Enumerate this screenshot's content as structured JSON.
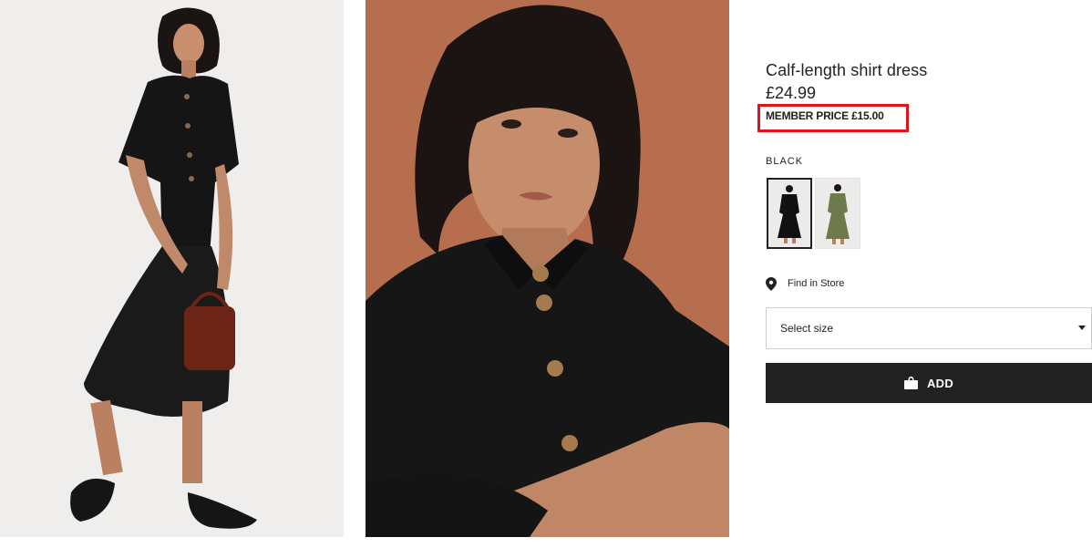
{
  "product": {
    "title": "Calf-length shirt dress",
    "price": "£24.99",
    "member_price": "MEMBER PRICE £15.00"
  },
  "color": {
    "selected_name": "BLACK",
    "swatches": [
      {
        "name": "black",
        "hex": "#111111",
        "selected": true
      },
      {
        "name": "khaki-green",
        "hex": "#6f7a4c",
        "selected": false
      }
    ]
  },
  "store": {
    "label": "Find in Store",
    "icon": "location-pin-icon"
  },
  "size": {
    "placeholder": "Select size",
    "icon": "caret-down-icon"
  },
  "add_button": {
    "label": "ADD",
    "icon": "shopping-bag-icon"
  },
  "highlight": {
    "color": "#e0141e"
  },
  "images": {
    "left_background": "#efeeec",
    "right_background": "#b76e4f"
  }
}
